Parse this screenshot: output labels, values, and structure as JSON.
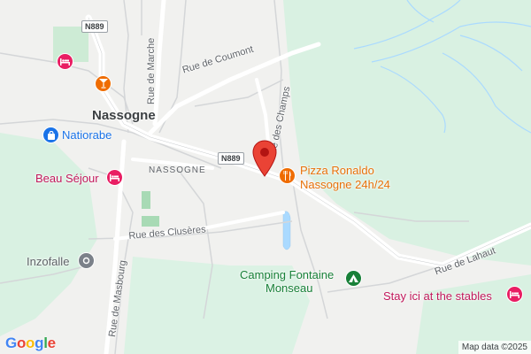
{
  "map": {
    "roads": {
      "n889_a": "N889",
      "n889_b": "N889",
      "rue_de_coumont": "Rue de Coumont",
      "rue_de_marche": "Rue de Marche",
      "rue_des_champs": "Rue des Champs",
      "rue_des_cluseres": "Rue des Clusères",
      "rue_de_masbourg": "Rue de Masbourg",
      "rue_de_lahaut": "Rue de Lahaut"
    },
    "places": {
      "town": "Nassogne",
      "locality": "NASSOGNE"
    },
    "pois": {
      "natiorabe": "Natiorabe",
      "beau_sejour": "Beau Séjour",
      "pizza": "Pizza Ronaldo",
      "pizza_sub": "Nassogne 24h/24",
      "inzofalle": "Inzofalle",
      "camping": "Camping Fontaine",
      "camping_sub": "Monseau",
      "stay": "Stay ici at the stables"
    },
    "icons": {
      "lodging": "bed-icon",
      "bar": "cocktail-icon",
      "shopping": "shopping-bag-icon",
      "restaurant": "fork-knife-icon",
      "camping": "tent-icon",
      "place": "place-icon",
      "selected": "location-pin-icon"
    },
    "colors": {
      "land": "#f1f1ef",
      "forest": "#cfeedd",
      "water": "#aadaff",
      "road": "#ffffff",
      "lodging": "#e91e63",
      "food": "#ef6c00",
      "park": "#34a853",
      "shop": "#1a73e8",
      "marker": "#ea4335"
    }
  },
  "footer": {
    "logo": "Google",
    "attribution": "Map data ©2025"
  }
}
